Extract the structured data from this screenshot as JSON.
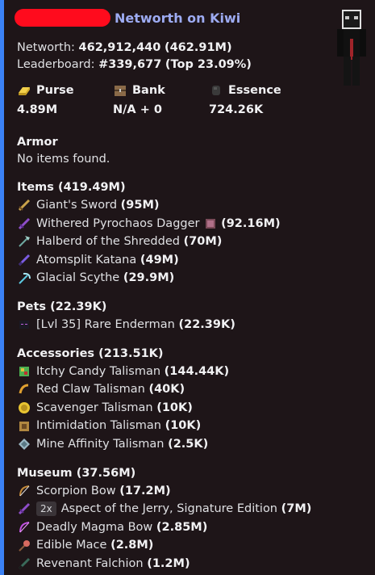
{
  "title": "Networth on Kiwi",
  "networth": {
    "label": "Networth:",
    "value": "462,912,440",
    "short": "(462.91M)"
  },
  "leaderboard": {
    "label": "Leaderboard:",
    "value": "#339,677",
    "top": "(Top 23.09%)"
  },
  "fields": [
    {
      "name": "Purse",
      "value": "4.89M",
      "icon": "gold-ingot-icon",
      "color": "#e8c431"
    },
    {
      "name": "Bank",
      "value": "N/A + 0",
      "icon": "chest-icon",
      "color": "#8a6a48"
    },
    {
      "name": "Essence",
      "value": "724.26K",
      "icon": "essence-icon",
      "color": "#3a3a3a"
    }
  ],
  "armor": {
    "title": "Armor",
    "empty": "No items found."
  },
  "items": {
    "title": "Items (419.49M)",
    "list": [
      {
        "name": "Giant's Sword",
        "value": "(95M)",
        "icon": "giants-sword-icon",
        "color": "#c9a24a"
      },
      {
        "name": "Withered Pyrochaos Dagger",
        "value": "(92.16M)",
        "icon": "dagger-icon",
        "color": "#8e4dc9",
        "extra_icon": "gem-icon"
      },
      {
        "name": "Halberd of the Shredded",
        "value": "(70M)",
        "icon": "halberd-icon",
        "color": "#6fa8a0"
      },
      {
        "name": "Atomsplit Katana",
        "value": "(49M)",
        "icon": "katana-icon",
        "color": "#7b5ce0"
      },
      {
        "name": "Glacial Scythe",
        "value": "(29.9M)",
        "icon": "scythe-icon",
        "color": "#5cc8e0"
      }
    ]
  },
  "pets": {
    "title": "Pets (22.39K)",
    "list": [
      {
        "name": "[Lvl 35] Rare Enderman",
        "value": "(22.39K)",
        "icon": "enderman-icon",
        "color": "#1a1a24"
      }
    ]
  },
  "accessories": {
    "title": "Accessories (213.51K)",
    "list": [
      {
        "name": "Itchy Candy Talisman",
        "value": "(144.44K)",
        "icon": "candy-icon",
        "color": "#4caf50"
      },
      {
        "name": "Red Claw Talisman",
        "value": "(40K)",
        "icon": "claw-icon",
        "color": "#e0a030"
      },
      {
        "name": "Scavenger Talisman",
        "value": "(10K)",
        "icon": "scavenger-icon",
        "color": "#e8c431"
      },
      {
        "name": "Intimidation Talisman",
        "value": "(10K)",
        "icon": "intimidation-icon",
        "color": "#b08840"
      },
      {
        "name": "Mine Affinity Talisman",
        "value": "(2.5K)",
        "icon": "mine-icon",
        "color": "#9bb8c4"
      }
    ]
  },
  "museum": {
    "title": "Museum (37.56M)",
    "list": [
      {
        "name": "Scorpion Bow",
        "value": "(17.2M)",
        "icon": "bow-icon",
        "color": "#c48a3a"
      },
      {
        "name": "Aspect of the Jerry, Signature Edition",
        "value": "(7M)",
        "icon": "aspect-icon",
        "color": "#8e4dc9",
        "badge": "2x"
      },
      {
        "name": "Deadly Magma Bow",
        "value": "(2.85M)",
        "icon": "magma-bow-icon",
        "color": "#c050e0"
      },
      {
        "name": "Edible Mace",
        "value": "(2.8M)",
        "icon": "mace-icon",
        "color": "#d86a60"
      },
      {
        "name": "Revenant Falchion",
        "value": "(1.2M)",
        "icon": "falchion-icon",
        "color": "#3a6a5a"
      }
    ]
  }
}
